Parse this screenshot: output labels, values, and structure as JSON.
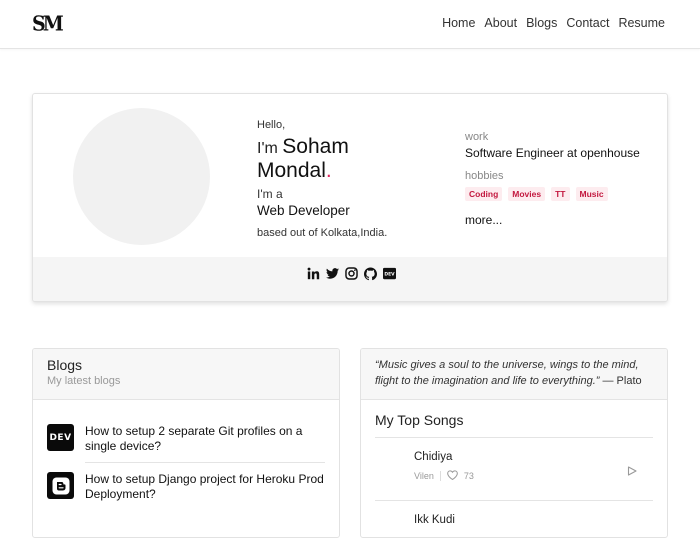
{
  "header": {
    "logo": "SM",
    "nav": [
      "Home",
      "About",
      "Blogs",
      "Contact",
      "Resume"
    ]
  },
  "profile": {
    "hello": "Hello,",
    "im": "I'm",
    "name_first": "Soham",
    "name_last": "Mondal",
    "name_dot": ".",
    "ima": "I'm a",
    "role": "Web Developer",
    "based": "based out of Kolkata,India.",
    "work_label": "work",
    "work_value": "Software Engineer at openhouse",
    "hobbies_label": "hobbies",
    "hobbies": [
      "Coding",
      "Movies",
      "TT",
      "Music"
    ],
    "more": "more...",
    "social_icons": [
      "linkedin-icon",
      "twitter-icon",
      "instagram-icon",
      "github-icon",
      "dev-icon"
    ],
    "accent_color": "#e0245e"
  },
  "blogs": {
    "title": "Blogs",
    "subtitle": "My latest blogs",
    "items": [
      {
        "icon": "DEV",
        "title": "How to setup 2 separate Git profiles on a single device?"
      },
      {
        "icon": "blogger-icon",
        "title": "How to setup Django project for Heroku Prod Deployment?"
      }
    ]
  },
  "songs": {
    "quote": "“Music gives a soul to the universe, wings to the mind, flight to the imagination and life to everything.”",
    "quote_author": "— Plato",
    "title": "My Top Songs",
    "items": [
      {
        "name": "Chidiya",
        "artist": "Vilen",
        "likes": "73"
      },
      {
        "name": "Ikk Kudi",
        "artist": "",
        "likes": ""
      }
    ]
  }
}
